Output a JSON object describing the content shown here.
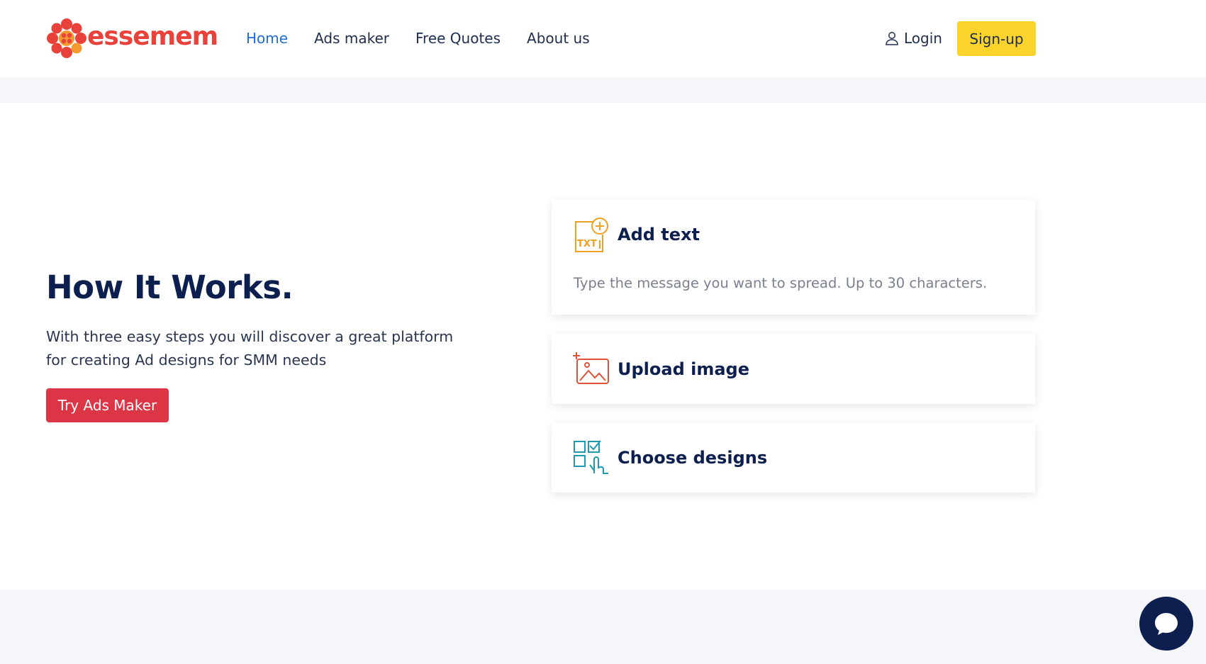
{
  "header": {
    "logo_text": "essemem",
    "nav": [
      "Home",
      "Ads maker",
      "Free Quotes",
      "About us"
    ],
    "active_nav": "Home",
    "login_label": "Login",
    "signup_label": "Sign-up"
  },
  "hero": {
    "title": "How It Works.",
    "subtitle_line1": "With three easy steps you will discover a great platform",
    "subtitle_line2": "for creating Ad designs for SMM needs",
    "cta_label": "Try Ads Maker"
  },
  "steps": [
    {
      "title": "Add text",
      "description": "Type the message you want to spread. Up to 30 characters.",
      "icon": "add-text-icon",
      "icon_color": "#f0a020"
    },
    {
      "title": "Upload image",
      "icon": "upload-image-icon",
      "icon_color": "#e0523a"
    },
    {
      "title": "Choose designs",
      "icon": "choose-designs-icon",
      "icon_color": "#1f9ab0"
    }
  ],
  "colors": {
    "brand": "#e8423b",
    "nav_active": "#1f6bd6",
    "signup_bg": "#fbd32b",
    "cta_bg": "#dc3545",
    "heading": "#0d1f4e",
    "chat_bg": "#0d1f4e"
  }
}
